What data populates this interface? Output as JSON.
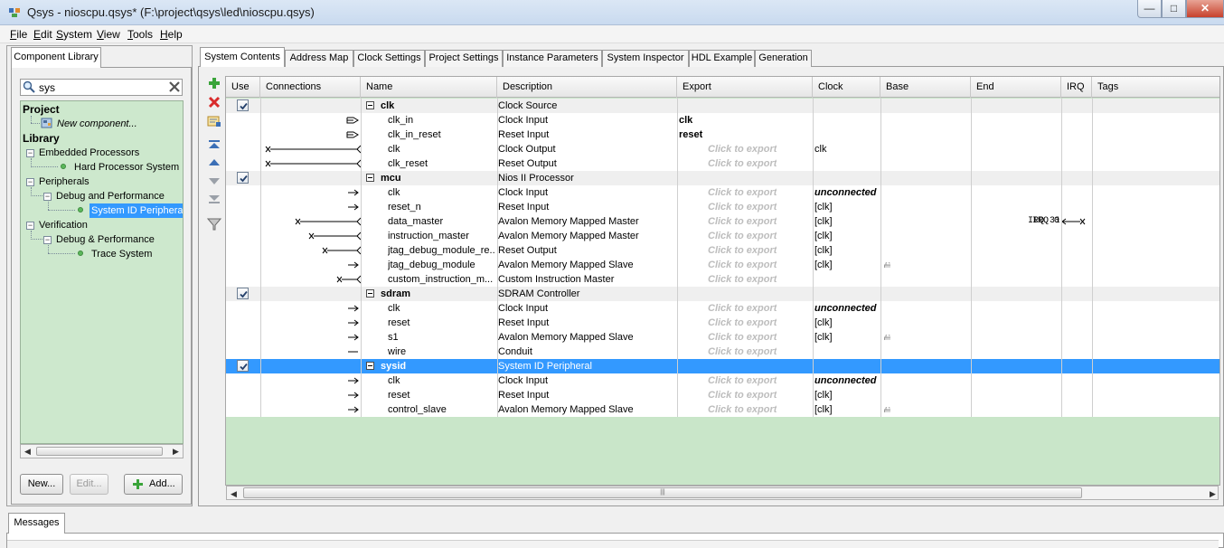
{
  "window": {
    "title": "Qsys - nioscpu.qsys* (F:\\project\\qsys\\led\\nioscpu.qsys)"
  },
  "menu": [
    "File",
    "Edit",
    "System",
    "View",
    "Tools",
    "Help"
  ],
  "menu_mnemonics": [
    "F",
    "E",
    "S",
    "V",
    "T",
    "H"
  ],
  "left": {
    "tab": "Component Library",
    "search": {
      "value": "sys",
      "placeholder": ""
    },
    "tree": {
      "project": "Project",
      "new_component": "New component...",
      "library": "Library",
      "embedded": "Embedded Processors",
      "hps": "Hard Processor System",
      "peripherals": "Peripherals",
      "debug_perf": "Debug and Performance",
      "sysid_periph": "System ID Peripheral",
      "verification": "Verification",
      "debug_perf2": "Debug & Performance",
      "trace": "Trace System"
    },
    "buttons": {
      "new": "New...",
      "edit": "Edit...",
      "add": "Add..."
    }
  },
  "tabs": [
    "System Contents",
    "Address Map",
    "Clock Settings",
    "Project Settings",
    "Instance Parameters",
    "System Inspector",
    "HDL Example",
    "Generation"
  ],
  "columns": [
    "Use",
    "Connections",
    "Name",
    "Description",
    "Export",
    "Clock",
    "Base",
    "End",
    "IRQ",
    "Tags"
  ],
  "export_placeholder": "Click to export",
  "rows": [
    {
      "kind": "group",
      "name": "clk",
      "desc": "Clock Source",
      "export": "",
      "clock": "",
      "base": "",
      "end": "",
      "irq": ""
    },
    {
      "kind": "child",
      "name": "clk_in",
      "desc": "Clock Input",
      "export": "clk",
      "clock": "",
      "base": "",
      "end": "",
      "irq": ""
    },
    {
      "kind": "child",
      "name": "clk_in_reset",
      "desc": "Reset Input",
      "export": "reset",
      "clock": "",
      "base": "",
      "end": "",
      "irq": ""
    },
    {
      "kind": "child",
      "name": "clk",
      "desc": "Clock Output",
      "export": "ph",
      "clock": "clk",
      "base": "",
      "end": "",
      "irq": ""
    },
    {
      "kind": "child",
      "name": "clk_reset",
      "desc": "Reset Output",
      "export": "ph",
      "clock": "",
      "base": "",
      "end": "",
      "irq": ""
    },
    {
      "kind": "group",
      "name": "mcu",
      "desc": "Nios II Processor",
      "export": "",
      "clock": "",
      "base": "",
      "end": "",
      "irq": ""
    },
    {
      "kind": "child",
      "name": "clk",
      "desc": "Clock Input",
      "export": "ph",
      "clock": "unconnected",
      "base": "",
      "end": "",
      "irq": ""
    },
    {
      "kind": "child",
      "name": "reset_n",
      "desc": "Reset Input",
      "export": "ph",
      "clock": "[clk]",
      "base": "",
      "end": "",
      "irq": ""
    },
    {
      "kind": "child",
      "name": "data_master",
      "desc": "Avalon Memory Mapped Master",
      "export": "ph",
      "clock": "[clk]",
      "base": "",
      "end": "IRQ 0",
      "irq": "IRQ 31"
    },
    {
      "kind": "child",
      "name": "instruction_master",
      "desc": "Avalon Memory Mapped Master",
      "export": "ph",
      "clock": "[clk]",
      "base": "",
      "end": "",
      "irq": ""
    },
    {
      "kind": "child",
      "name": "jtag_debug_module_re...",
      "desc": "Reset Output",
      "export": "ph",
      "clock": "[clk]",
      "base": "",
      "end": "",
      "irq": ""
    },
    {
      "kind": "child",
      "name": "jtag_debug_module",
      "desc": "Avalon Memory Mapped Slave",
      "export": "ph",
      "clock": "[clk]",
      "base": "",
      "end": "",
      "irq": ""
    },
    {
      "kind": "child",
      "name": "custom_instruction_m...",
      "desc": "Custom Instruction Master",
      "export": "ph",
      "clock": "",
      "base": "",
      "end": "",
      "irq": ""
    },
    {
      "kind": "group",
      "name": "sdram",
      "desc": "SDRAM Controller",
      "export": "",
      "clock": "",
      "base": "",
      "end": "",
      "irq": ""
    },
    {
      "kind": "child",
      "name": "clk",
      "desc": "Clock Input",
      "export": "ph",
      "clock": "unconnected",
      "base": "",
      "end": "",
      "irq": ""
    },
    {
      "kind": "child",
      "name": "reset",
      "desc": "Reset Input",
      "export": "ph",
      "clock": "[clk]",
      "base": "",
      "end": "",
      "irq": ""
    },
    {
      "kind": "child",
      "name": "s1",
      "desc": "Avalon Memory Mapped Slave",
      "export": "ph",
      "clock": "[clk]",
      "base": "",
      "end": "",
      "irq": ""
    },
    {
      "kind": "child",
      "name": "wire",
      "desc": "Conduit",
      "export": "ph",
      "clock": "",
      "base": "",
      "end": "",
      "irq": ""
    },
    {
      "kind": "group",
      "name": "sysid",
      "desc": "System ID Peripheral",
      "export": "",
      "clock": "",
      "base": "",
      "end": "",
      "irq": "",
      "selected": true
    },
    {
      "kind": "child",
      "name": "clk",
      "desc": "Clock Input",
      "export": "ph",
      "clock": "unconnected",
      "base": "",
      "end": "",
      "irq": ""
    },
    {
      "kind": "child",
      "name": "reset",
      "desc": "Reset Input",
      "export": "ph",
      "clock": "[clk]",
      "base": "",
      "end": "",
      "irq": ""
    },
    {
      "kind": "child",
      "name": "control_slave",
      "desc": "Avalon Memory Mapped Slave",
      "export": "ph",
      "clock": "[clk]",
      "base": "",
      "end": "",
      "irq": ""
    }
  ],
  "messages": {
    "tab": "Messages"
  },
  "colors": {
    "selection": "#3399ff",
    "library_bg": "#cde8cd",
    "grid_empty": "#c9e6c9"
  }
}
